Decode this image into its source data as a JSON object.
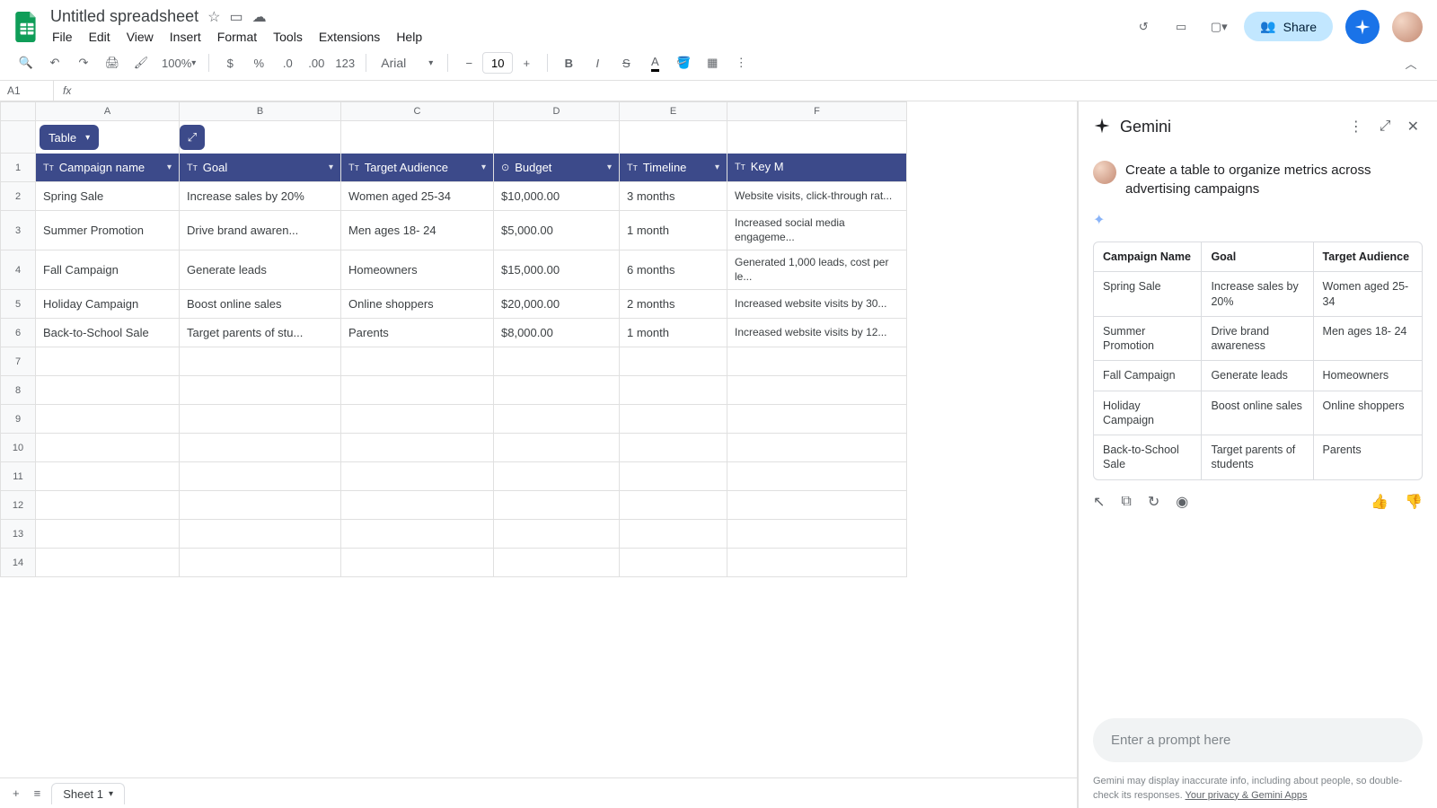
{
  "doc": {
    "title": "Untitled spreadsheet"
  },
  "menus": {
    "file": "File",
    "edit": "Edit",
    "view": "View",
    "insert": "Insert",
    "format": "Format",
    "tools": "Tools",
    "extensions": "Extensions",
    "help": "Help"
  },
  "share": {
    "label": "Share"
  },
  "toolbar": {
    "zoom": "100%",
    "font": "Arial",
    "fontSize": "10",
    "fmt123": "123"
  },
  "name_box": "A1",
  "columns": [
    "A",
    "B",
    "C",
    "D",
    "E",
    "F"
  ],
  "table_chip": "Table",
  "headers": {
    "campaign": "Campaign name",
    "goal": "Goal",
    "audience": "Target Audience",
    "budget": "Budget",
    "timeline": "Timeline",
    "keym": "Key M"
  },
  "rows": [
    {
      "n": "2",
      "a": "Spring Sale",
      "b": "Increase sales by 20%",
      "c": "Women aged 25-34",
      "d": "$10,000.00",
      "e": "3 months",
      "f": "Website visits, click-through rat..."
    },
    {
      "n": "3",
      "a": "Summer Promotion",
      "b": "Drive brand awaren...",
      "c": "Men ages 18- 24",
      "d": "$5,000.00",
      "e": "1 month",
      "f": "Increased social media engageme..."
    },
    {
      "n": "4",
      "a": "Fall Campaign",
      "b": "Generate leads",
      "c": "Homeowners",
      "d": "$15,000.00",
      "e": "6 months",
      "f": "Generated 1,000 leads, cost per le..."
    },
    {
      "n": "5",
      "a": "Holiday Campaign",
      "b": "Boost online sales",
      "c": "Online shoppers",
      "d": "$20,000.00",
      "e": "2 months",
      "f": "Increased website visits by 30..."
    },
    {
      "n": "6",
      "a": "Back-to-School Sale",
      "b": "Target parents of stu...",
      "c": "Parents",
      "d": "$8,000.00",
      "e": "1 month",
      "f": "Increased website visits by 12..."
    }
  ],
  "empty_rows": [
    "7",
    "8",
    "9",
    "10",
    "11",
    "12",
    "13",
    "14"
  ],
  "sheet_tab": "Sheet 1",
  "gemini": {
    "title": "Gemini",
    "prompt": "Create a table to organize metrics across advertising campaigns",
    "headers": {
      "c1": "Campaign Name",
      "c2": "Goal",
      "c3": "Target Audience"
    },
    "rows": [
      {
        "c1": "Spring Sale",
        "c2": "Increase sales by 20%",
        "c3": "Women aged 25-34"
      },
      {
        "c1": "Summer Promotion",
        "c2": "Drive brand awareness",
        "c3": "Men ages 18- 24"
      },
      {
        "c1": "Fall Campaign",
        "c2": "Generate leads",
        "c3": "Homeowners"
      },
      {
        "c1": "Holiday Campaign",
        "c2": "Boost online sales",
        "c3": "Online shoppers"
      },
      {
        "c1": "Back-to-School Sale",
        "c2": "Target parents of students",
        "c3": "Parents"
      }
    ],
    "input_placeholder": "Enter a prompt here",
    "disclaimer": "Gemini may display inaccurate info, including about people, so double-check its responses.",
    "disclaimer_link": "Your privacy & Gemini Apps"
  }
}
